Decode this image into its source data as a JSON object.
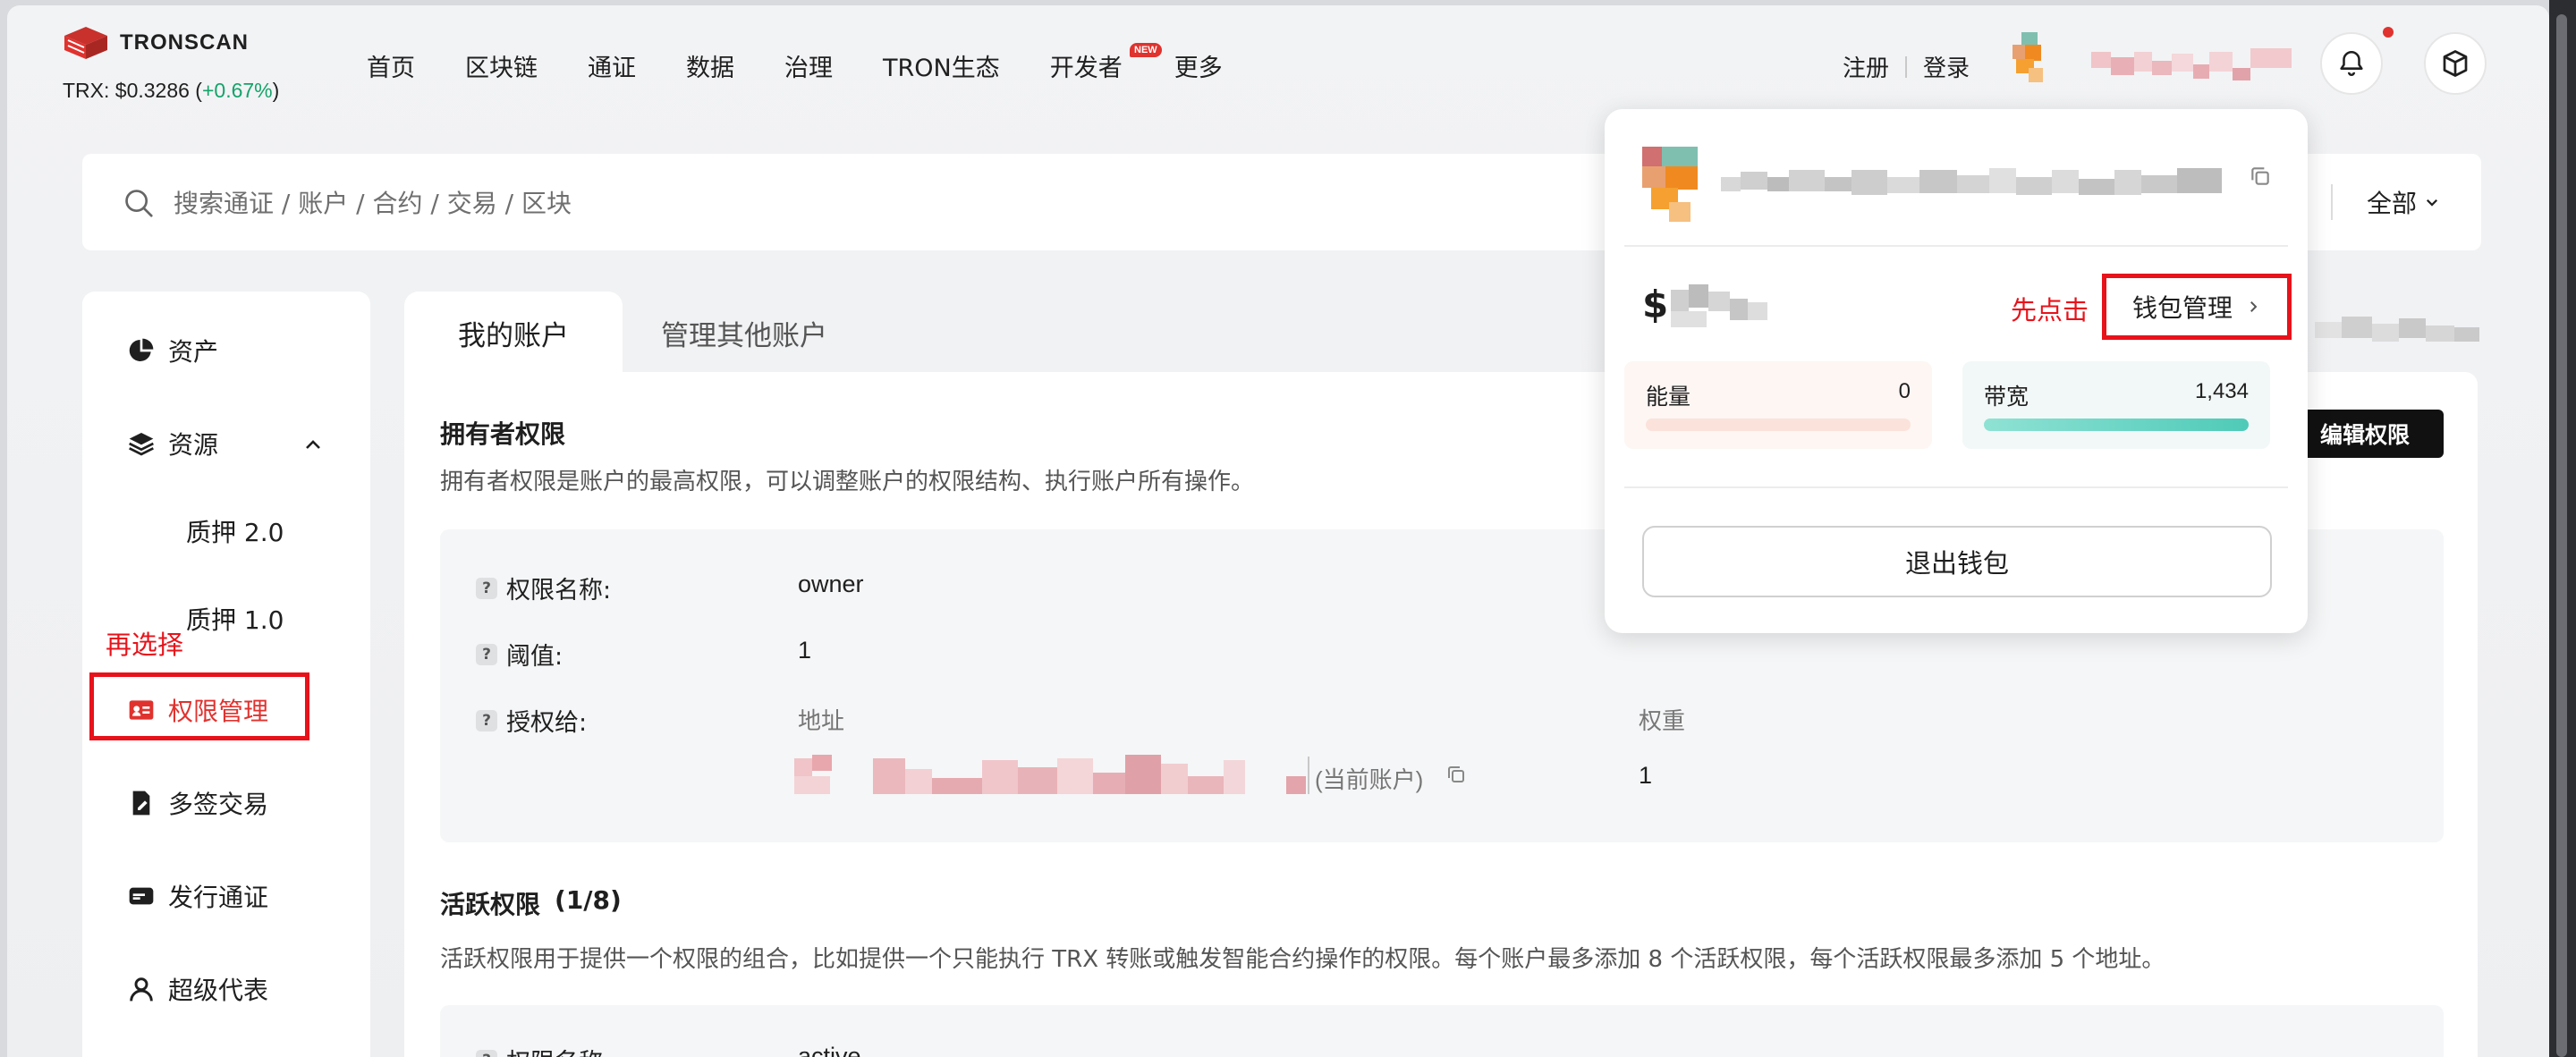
{
  "header": {
    "logo_text": "TRONSCAN",
    "price_label": "TRX: $0.3286 (",
    "price_change": "+0.67%",
    "price_close": ")",
    "nav": [
      "首页",
      "区块链",
      "通证",
      "数据",
      "治理",
      "TRON生态",
      "开发者",
      "更多"
    ],
    "nav_new_badge": "NEW",
    "register": "注册",
    "login": "登录"
  },
  "search": {
    "placeholder": "搜索通证 / 账户 / 合约 / 交易 / 区块",
    "filter": "全部"
  },
  "sidebar": {
    "assets": "资产",
    "resources": "资源",
    "stake2": "质押 2.0",
    "stake1": "质押 1.0",
    "permission": "权限管理",
    "multisig": "多签交易",
    "issue_token": "发行通证",
    "super_rep": "超级代表"
  },
  "annotations": {
    "then_select": "再选择",
    "click_first": "先点击"
  },
  "tabs": {
    "my_account": "我的账户",
    "other_accounts": "管理其他账户"
  },
  "owner": {
    "title": "拥有者权限",
    "desc": "拥有者权限是账户的最高权限，可以调整账户的权限结构、执行账户所有操作。",
    "name_label": "权限名称:",
    "name_value": "owner",
    "threshold_label": "阈值:",
    "threshold_value": "1",
    "grant_label": "授权给:",
    "address_head": "地址",
    "weight_head": "权重",
    "current_account": "(当前账户)",
    "weight_value": "1",
    "edit_button": "编辑权限"
  },
  "active": {
    "title": "活跃权限",
    "count": "(1/8)",
    "desc": "活跃权限用于提供一个权限的组合，比如提供一个只能执行 TRX 转账或触发智能合约操作的权限。每个账户最多添加 8 个活跃权限，每个活跃权限最多添加 5 个地址。",
    "name_label": "权限名称:",
    "name_value": "active"
  },
  "wallet_dropdown": {
    "balance_symbol": "$",
    "manage_button": "钱包管理",
    "energy_label": "能量",
    "energy_value": "0",
    "bandwidth_label": "带宽",
    "bandwidth_value": "1,434",
    "bandwidth_fill": 1.0,
    "energy_fill": 0.0,
    "logout": "退出钱包"
  },
  "colors": {
    "accent_red": "#e8121a",
    "positive": "#15a36b",
    "bandwidth": "#5fd3c2",
    "energy_track": "#fbe2da"
  }
}
